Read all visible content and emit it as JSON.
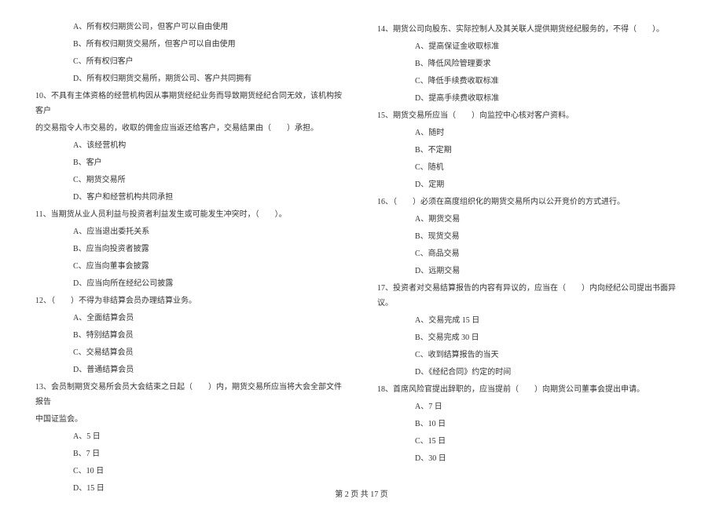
{
  "left": {
    "q9_opts": [
      "A、所有权归期货公司，但客户可以自由使用",
      "B、所有权归期货交易所，但客户可以自由使用",
      "C、所有权归客户",
      "D、所有权归期货交易所，期货公司、客户共同拥有"
    ],
    "q10_line1": "10、不具有主体资格的经营机构因从事期货经纪业务而导致期货经纪合同无效，该机构按客户",
    "q10_line2": "的交易指令人市交易的，收取的佣金应当返还给客户，交易结果由（　　）承担。",
    "q10_opts": [
      "A、该经营机构",
      "B、客户",
      "C、期货交易所",
      "D、客户和经营机构共同承担"
    ],
    "q11": "11、当期货从业人员利益与投资者利益发生或可能发生冲突时，（　　）。",
    "q11_opts": [
      "A、应当退出委托关系",
      "B、应当向投资者披露",
      "C、应当向董事会披露",
      "D、应当向所在经纪公司披露"
    ],
    "q12": "12、（　　）不得为非结算会员办理结算业务。",
    "q12_opts": [
      "A、全面结算会员",
      "B、特别结算会员",
      "C、交易结算会员",
      "D、普通结算会员"
    ],
    "q13_line1": "13、会员制期货交易所会员大会结束之日起（　　）内，期货交易所应当将大会全部文件报告",
    "q13_line2": "中国证监会。",
    "q13_opts": [
      "A、5 日",
      "B、7 日",
      "C、10 日",
      "D、15 日"
    ]
  },
  "right": {
    "q14": "14、期货公司向股东、实际控制人及其关联人提供期货经纪服务的，不得（　　）。",
    "q14_opts": [
      "A、提高保证金收取标准",
      "B、降低风险管理要求",
      "C、降低手续费收取标准",
      "D、提高手续费收取标准"
    ],
    "q15": "15、期货交易所应当（　　）向监控中心核对客户资料。",
    "q15_opts": [
      "A、随时",
      "B、不定期",
      "C、随机",
      "D、定期"
    ],
    "q16": "16、（　　）必须在高度组织化的期货交易所内以公开竞价的方式进行。",
    "q16_opts": [
      "A、期货交易",
      "B、现货交易",
      "C、商品交易",
      "D、远期交易"
    ],
    "q17": "17、投资者对交易结算报告的内容有异议的，应当在（　　）内向经纪公司提出书面异议。",
    "q17_opts": [
      "A、交易完成 15 日",
      "B、交易完成 30 日",
      "C、收到结算报告的当天",
      "D、《经纪合同》约定的时间"
    ],
    "q18": "18、首席风险官提出辞职的，应当提前（　　）向期货公司董事会提出申请。",
    "q18_opts": [
      "A、7 日",
      "B、10 日",
      "C、15 日",
      "D、30 日"
    ]
  },
  "footer": "第 2 页 共 17 页"
}
